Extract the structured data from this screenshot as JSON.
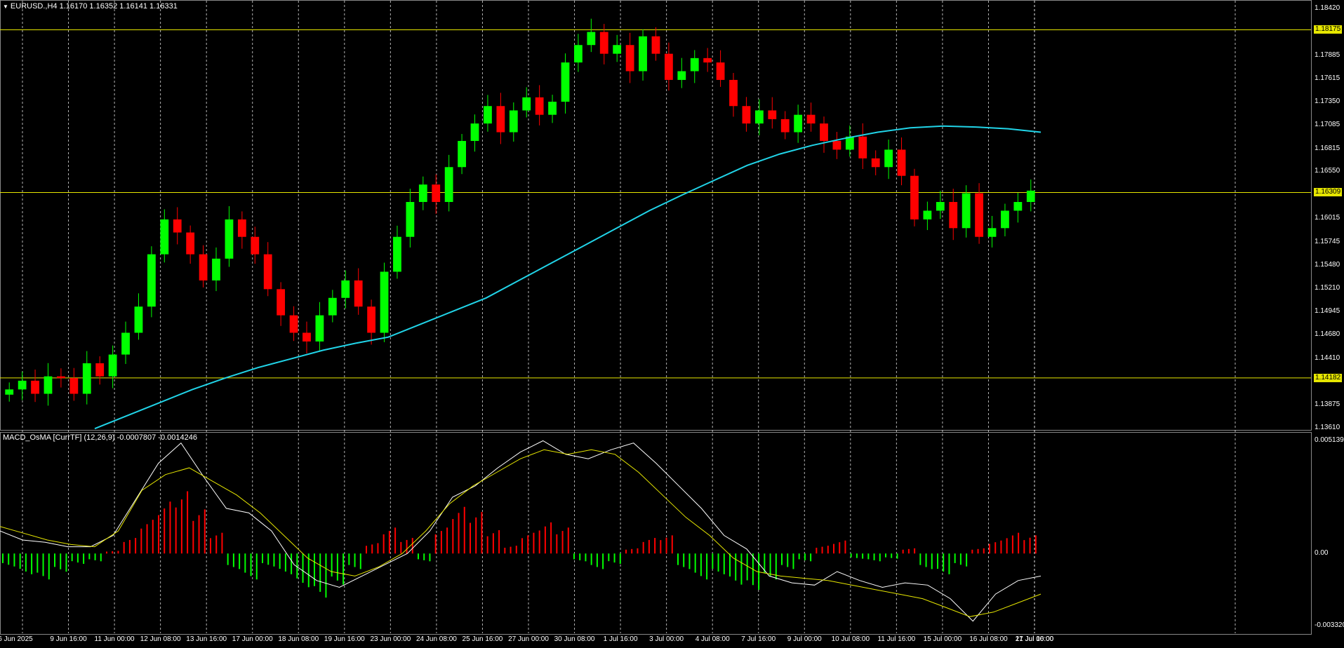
{
  "colors": {
    "background": "#000000",
    "bull": "#00ff00",
    "bear": "#ff0000",
    "ma": "#21d4e8",
    "hline": "#e6e600",
    "macd_main": "#ffffff",
    "macd_signal": "#e6e600",
    "grid": "#ffffff"
  },
  "header": {
    "symbol_icon": "triangle-down-icon",
    "title": "EURUSD.,H4  1.16170 1.16352 1.16141 1.16331"
  },
  "indicator_header": {
    "title": "MACD_OsMA [CurrTF] (12,26,9) -0.0007807 -0.0014246"
  },
  "price_axis": {
    "labels": [
      "1.18420",
      "1.18155",
      "1.17885",
      "1.17615",
      "1.17350",
      "1.17085",
      "1.16815",
      "1.16550",
      "1.16280",
      "1.16015",
      "1.15745",
      "1.15480",
      "1.15210",
      "1.14945",
      "1.14680",
      "1.14410",
      "1.14145",
      "1.13875",
      "1.13610"
    ],
    "ylim": [
      1.1361,
      1.1842
    ]
  },
  "price_tags": [
    {
      "value": 1.18175,
      "label": "1.18175"
    },
    {
      "value": 1.16309,
      "label": "1.16309"
    },
    {
      "value": 1.14182,
      "label": "1.14182"
    }
  ],
  "macd_axis": {
    "labels": [
      "0.0051395",
      "0.00",
      "-0.003320"
    ],
    "ylim": [
      -0.00332,
      0.0051395
    ]
  },
  "time_axis": {
    "labels": [
      "6 Jun 2025",
      "9 Jun 16:00",
      "11 Jun 00:00",
      "12 Jun 08:00",
      "13 Jun 16:00",
      "17 Jun 00:00",
      "18 Jun 08:00",
      "19 Jun 16:00",
      "23 Jun 00:00",
      "24 Jun 08:00",
      "25 Jun 16:00",
      "27 Jun 00:00",
      "30 Jun 08:00",
      "1 Jul 16:00",
      "3 Jul 00:00",
      "4 Jul 08:00",
      "7 Jul 16:00",
      "9 Jul 00:00",
      "10 Jul 08:00",
      "11 Jul 16:00",
      "15 Jul 00:00",
      "16 Jul 08:00",
      "17 Jul 16:00",
      "21 Jul 00:00"
    ]
  },
  "chart_data": [
    {
      "type": "candlestick",
      "title": "EURUSD.,H4",
      "ylim": [
        1.1361,
        1.1842
      ],
      "grid": true,
      "close_path": [
        1.1405,
        1.1415,
        1.14,
        1.142,
        1.1418,
        1.14,
        1.1435,
        1.142,
        1.1445,
        1.147,
        1.15,
        1.156,
        1.16,
        1.1585,
        1.156,
        1.153,
        1.1555,
        1.16,
        1.158,
        1.156,
        1.152,
        1.149,
        1.147,
        1.146,
        1.149,
        1.151,
        1.153,
        1.15,
        1.147,
        1.154,
        1.158,
        1.162,
        1.164,
        1.162,
        1.166,
        1.169,
        1.171,
        1.173,
        1.17,
        1.1725,
        1.174,
        1.172,
        1.1735,
        1.178,
        1.18,
        1.1815,
        1.179,
        1.18,
        1.177,
        1.181,
        1.179,
        1.176,
        1.177,
        1.1785,
        1.178,
        1.176,
        1.173,
        1.171,
        1.1725,
        1.1715,
        1.17,
        1.172,
        1.171,
        1.169,
        1.168,
        1.1695,
        1.167,
        1.166,
        1.168,
        1.165,
        1.16,
        1.161,
        1.162,
        1.159,
        1.163,
        1.158,
        1.159,
        1.161,
        1.162,
        1.1633
      ],
      "ma_path": [
        1.136,
        1.1375,
        1.139,
        1.1405,
        1.1418,
        1.143,
        1.144,
        1.145,
        1.1458,
        1.1465,
        1.148,
        1.1495,
        1.151,
        1.153,
        1.155,
        1.157,
        1.159,
        1.161,
        1.1628,
        1.1645,
        1.1662,
        1.1675,
        1.1685,
        1.1693,
        1.17,
        1.1705,
        1.1707,
        1.1706,
        1.1704,
        1.17
      ]
    },
    {
      "type": "bar",
      "title": "MACD_OsMA [CurrTF] (12,26,9)",
      "ylim": [
        -0.00332,
        0.0051395
      ],
      "histogram": [
        -0.0005,
        -0.0008,
        -0.001,
        -0.0007,
        -0.0004,
        -0.0003,
        0.0001,
        0.0006,
        0.0013,
        0.002,
        0.0024,
        0.0017,
        0.0008,
        -0.0006,
        -0.001,
        -0.0005,
        -0.0008,
        -0.0013,
        -0.0017,
        -0.0012,
        -0.0006,
        0.0004,
        0.001,
        0.0006,
        -0.0003,
        0.001,
        0.0018,
        0.0016,
        0.0009,
        0.0003,
        0.0008,
        0.0012,
        0.001,
        -0.0003,
        -0.0006,
        -0.0004,
        0.0002,
        0.0006,
        0.0007,
        -0.0006,
        -0.001,
        -0.0008,
        -0.0012,
        -0.0014,
        -0.001,
        -0.0006,
        -0.0003,
        0.0003,
        0.0005,
        -0.0002,
        -0.0003,
        -0.0002,
        0.0002,
        -0.0006,
        -0.0008,
        -0.0005,
        0.0002,
        0.0005,
        0.0008,
        0.0007
      ],
      "main_line": [
        0.001,
        0.0006,
        0.0005,
        0.0003,
        0.0003,
        0.0008,
        0.0024,
        0.004,
        0.0049,
        0.0034,
        0.002,
        0.0018,
        0.001,
        -0.0005,
        -0.0012,
        -0.0015,
        -0.001,
        -0.0005,
        0.0,
        0.001,
        0.0025,
        0.003,
        0.0038,
        0.0045,
        0.005,
        0.0044,
        0.0042,
        0.0046,
        0.0049,
        0.004,
        0.003,
        0.002,
        0.0008,
        0.0002,
        -0.001,
        -0.0013,
        -0.0014,
        -0.0008,
        -0.0012,
        -0.0015,
        -0.0013,
        -0.0014,
        -0.002,
        -0.003,
        -0.0018,
        -0.0012,
        -0.001
      ],
      "signal_line": [
        0.0012,
        0.0009,
        0.0006,
        0.0004,
        0.0003,
        0.001,
        0.0028,
        0.0035,
        0.0038,
        0.0032,
        0.0026,
        0.0018,
        0.0008,
        -0.0002,
        -0.0008,
        -0.001,
        -0.0006,
        0.0,
        0.001,
        0.0022,
        0.003,
        0.0036,
        0.0042,
        0.0046,
        0.0044,
        0.0046,
        0.0044,
        0.0036,
        0.0026,
        0.0016,
        0.0008,
        -0.0002,
        -0.0008,
        -0.001,
        -0.0011,
        -0.0012,
        -0.0014,
        -0.0016,
        -0.0018,
        -0.002,
        -0.0024,
        -0.0028,
        -0.0026,
        -0.0022,
        -0.0018
      ]
    }
  ]
}
